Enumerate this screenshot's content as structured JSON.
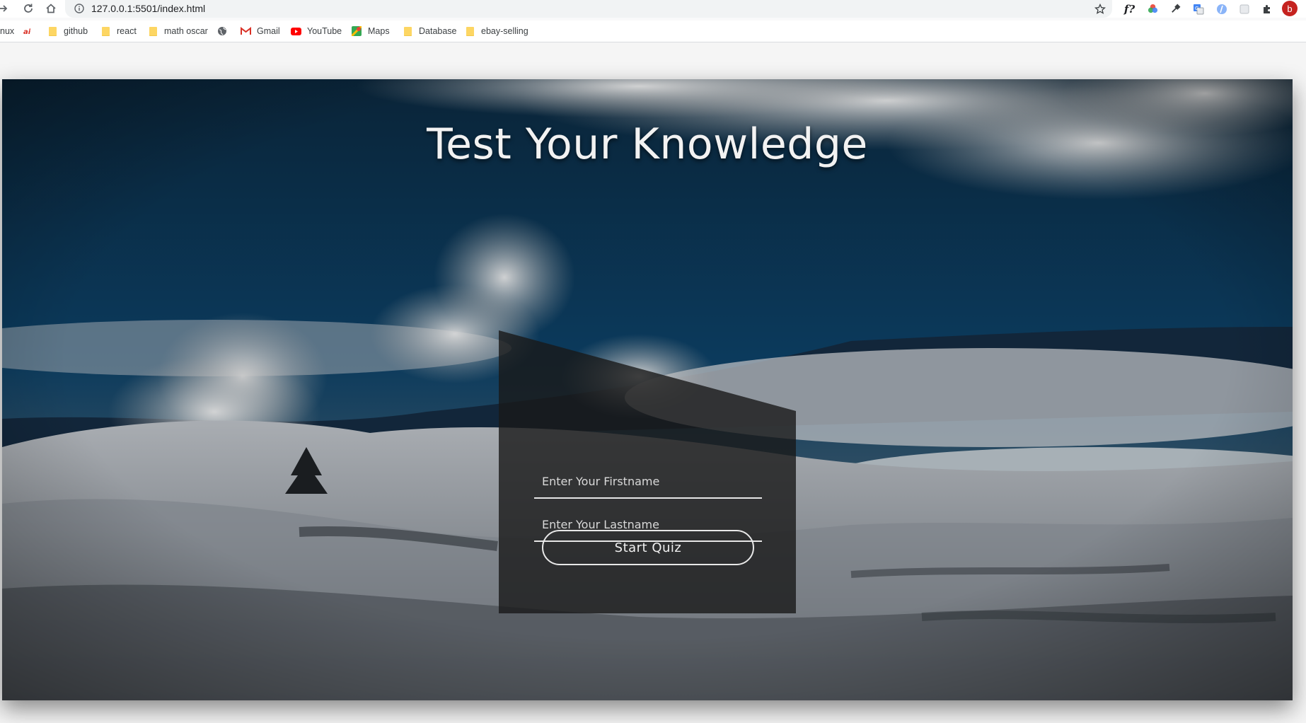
{
  "browser": {
    "url": "127.0.0.1:5501/index.html",
    "bookmarks": [
      {
        "label": "nux",
        "icon": "generic-favicon-icon"
      },
      {
        "label": "",
        "icon": "brand-red-icon"
      },
      {
        "label": "github",
        "icon": "folder-icon"
      },
      {
        "label": "react",
        "icon": "folder-icon"
      },
      {
        "label": "math oscar",
        "icon": "folder-icon"
      },
      {
        "label": "",
        "icon": "globe-icon"
      },
      {
        "label": "Gmail",
        "icon": "gmail-icon"
      },
      {
        "label": "YouTube",
        "icon": "youtube-icon"
      },
      {
        "label": "Maps",
        "icon": "maps-icon"
      },
      {
        "label": "Database",
        "icon": "folder-icon"
      },
      {
        "label": "ebay-selling",
        "icon": "folder-icon"
      }
    ],
    "toolbar_icons": [
      "star-icon",
      "font-f-icon",
      "color-wheel-icon",
      "eyedropper-icon",
      "translate-icon",
      "extension-icon",
      "extension-icon",
      "puzzle-icon",
      "profile-avatar"
    ],
    "profile_initial": "b",
    "font_icon_text": "f?"
  },
  "page": {
    "title": "Test Your Knowledge",
    "form": {
      "firstname_placeholder": "Enter Your Firstname",
      "lastname_placeholder": "Enter Your Lastname",
      "start_label": "Start Quiz"
    }
  },
  "colors": {
    "sky": "#0b2c46",
    "panel": "#191919",
    "text": "#f2f2f2",
    "avatar": "#c5221f"
  }
}
